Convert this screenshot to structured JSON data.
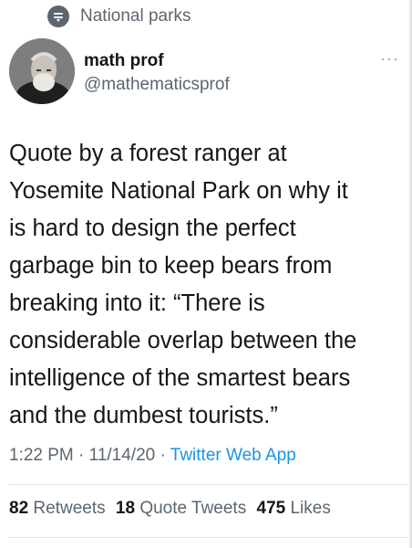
{
  "topic": {
    "label": "National parks",
    "icon": "topic-icon"
  },
  "author": {
    "name": "math prof",
    "handle": "@mathematicsprof",
    "avatar": "avatar"
  },
  "more_label": "···",
  "tweet": {
    "text": "Quote by a forest ranger at\nYosemite National Park on why it\nis hard to design the perfect\ngarbage bin to keep bears from\nbreaking into it:  “There is\nconsiderable overlap between the\nintelligence of the smartest bears\nand the dumbest tourists.”"
  },
  "meta": {
    "time": "1:22 PM",
    "sep1": " · ",
    "date": "11/14/20",
    "sep2": " · ",
    "app": "Twitter Web App"
  },
  "stats": {
    "retweets_count": "82",
    "retweets_label": "Retweets",
    "quotes_count": "18",
    "quotes_label": "Quote Tweets",
    "likes_count": "475",
    "likes_label": "Likes"
  },
  "colors": {
    "link": "#1b95e0",
    "muted": "#5b6670",
    "text": "#14171a"
  }
}
